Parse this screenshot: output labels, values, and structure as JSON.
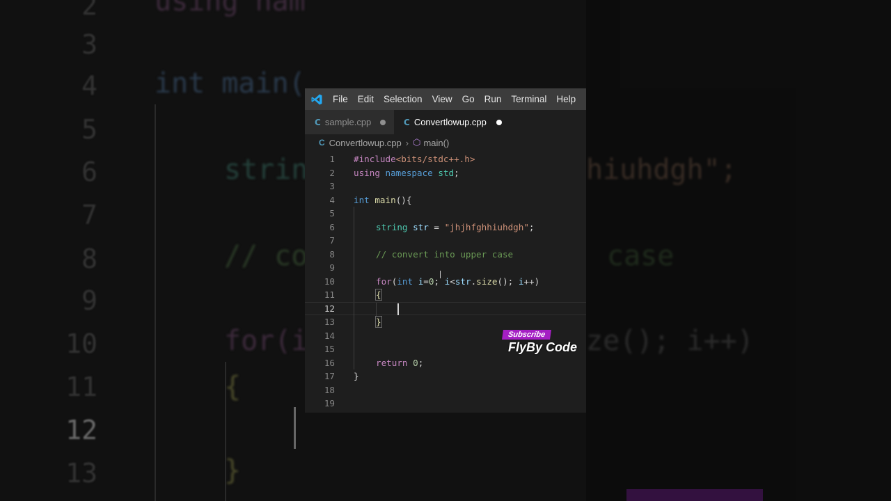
{
  "background": {
    "line_numbers": [
      "2",
      "3",
      "4",
      "5",
      "6",
      "7",
      "8",
      "9",
      "10",
      "11",
      "12",
      "13"
    ],
    "code_fragments": {
      "l2": "using nam",
      "l4": "int main(",
      "l6a": "strin",
      "l6b": "hiuhdgh\";",
      "l8a": "// co",
      "l8b": "case",
      "l10a": "for(i",
      "l10b": "ze(); i++)",
      "l11": "{",
      "l13": "}"
    }
  },
  "menubar": {
    "items": [
      "File",
      "Edit",
      "Selection",
      "View",
      "Go",
      "Run",
      "Terminal",
      "Help"
    ]
  },
  "tabs": [
    {
      "icon": "C",
      "label": "sample.cpp",
      "active": false
    },
    {
      "icon": "C",
      "label": "Convertlowup.cpp",
      "active": true
    }
  ],
  "breadcrumb": {
    "file": "Convertlowup.cpp",
    "symbol": "main()"
  },
  "editor": {
    "current_line": 12,
    "line_numbers": [
      "1",
      "2",
      "3",
      "4",
      "5",
      "6",
      "7",
      "8",
      "9",
      "10",
      "11",
      "12",
      "13",
      "14",
      "15",
      "16",
      "17",
      "18",
      "19"
    ],
    "lines": {
      "l1_pre": "#include",
      "l1_inc": "<bits/stdc++.h>",
      "l2_kw": "using",
      "l2_kw2": "namespace",
      "l2_ns": "std",
      "l2_end": ";",
      "l4_type": "int",
      "l4_fn": "main",
      "l4_end": "(){",
      "l6_type": "string",
      "l6_var": "str",
      "l6_eq": " = ",
      "l6_str": "\"jhjhfghhiuhdgh\"",
      "l6_end": ";",
      "l8_com": "// convert into upper case",
      "l10_for": "for",
      "l10_p1": "(",
      "l10_int": "int",
      "l10_i": "i",
      "l10_eq": "=",
      "l10_zero": "0",
      "l10_semi": "; ",
      "l10_i2": "i",
      "l10_lt": "<",
      "l10_str": "str",
      "l10_dot": ".",
      "l10_size": "size",
      "l10_call": "(); ",
      "l10_i3": "i",
      "l10_end": "++)",
      "l11": "{",
      "l13": "}",
      "l16_ret": "return",
      "l16_sp": " ",
      "l16_zero": "0",
      "l16_end": ";",
      "l17": "}"
    }
  },
  "watermark": {
    "badge": "Subscribe",
    "name": "FlyBy Code"
  },
  "colors": {
    "menubar": "#3c3c3c",
    "tab_inactive": "#2d2d2d",
    "editor_bg": "#1e1e1e",
    "keyword": "#569cd6",
    "control": "#c586c0",
    "type": "#4ec9b0",
    "function": "#dcdcaa",
    "variable": "#9cdcfe",
    "string": "#ce9178",
    "number": "#b5cea8",
    "comment": "#6a9955",
    "subscribe_badge": "#a51fc4",
    "vscode_logo": "#23a9f2"
  }
}
